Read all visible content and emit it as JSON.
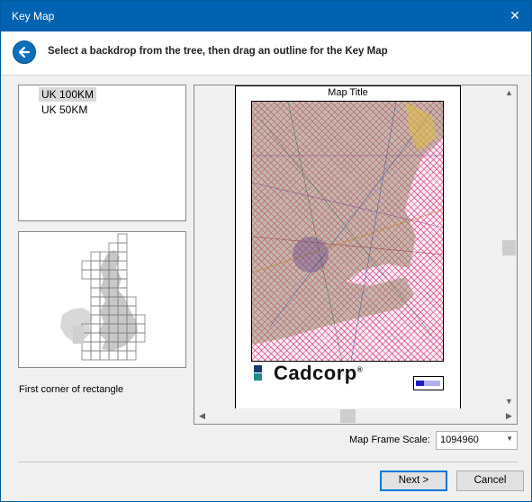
{
  "window": {
    "title": "Key Map",
    "close_glyph": "✕"
  },
  "instruction": "Select a backdrop from the tree, then drag an outline for the Key Map",
  "tree": {
    "items": [
      {
        "label": "UK 100KM",
        "selected": true
      },
      {
        "label": "UK 50KM",
        "selected": false
      }
    ]
  },
  "status_text": "First corner of rectangle",
  "preview": {
    "map_title": "Map Title",
    "logo_text": "Cadcorp",
    "logo_mark": "®"
  },
  "scale": {
    "label": "Map Frame Scale:",
    "value": "1094960"
  },
  "buttons": {
    "next": "Next >",
    "cancel": "Cancel"
  },
  "colors": {
    "titlebar": "#0063b1",
    "accent": "#0078d7",
    "hatch": "#cc0066"
  }
}
